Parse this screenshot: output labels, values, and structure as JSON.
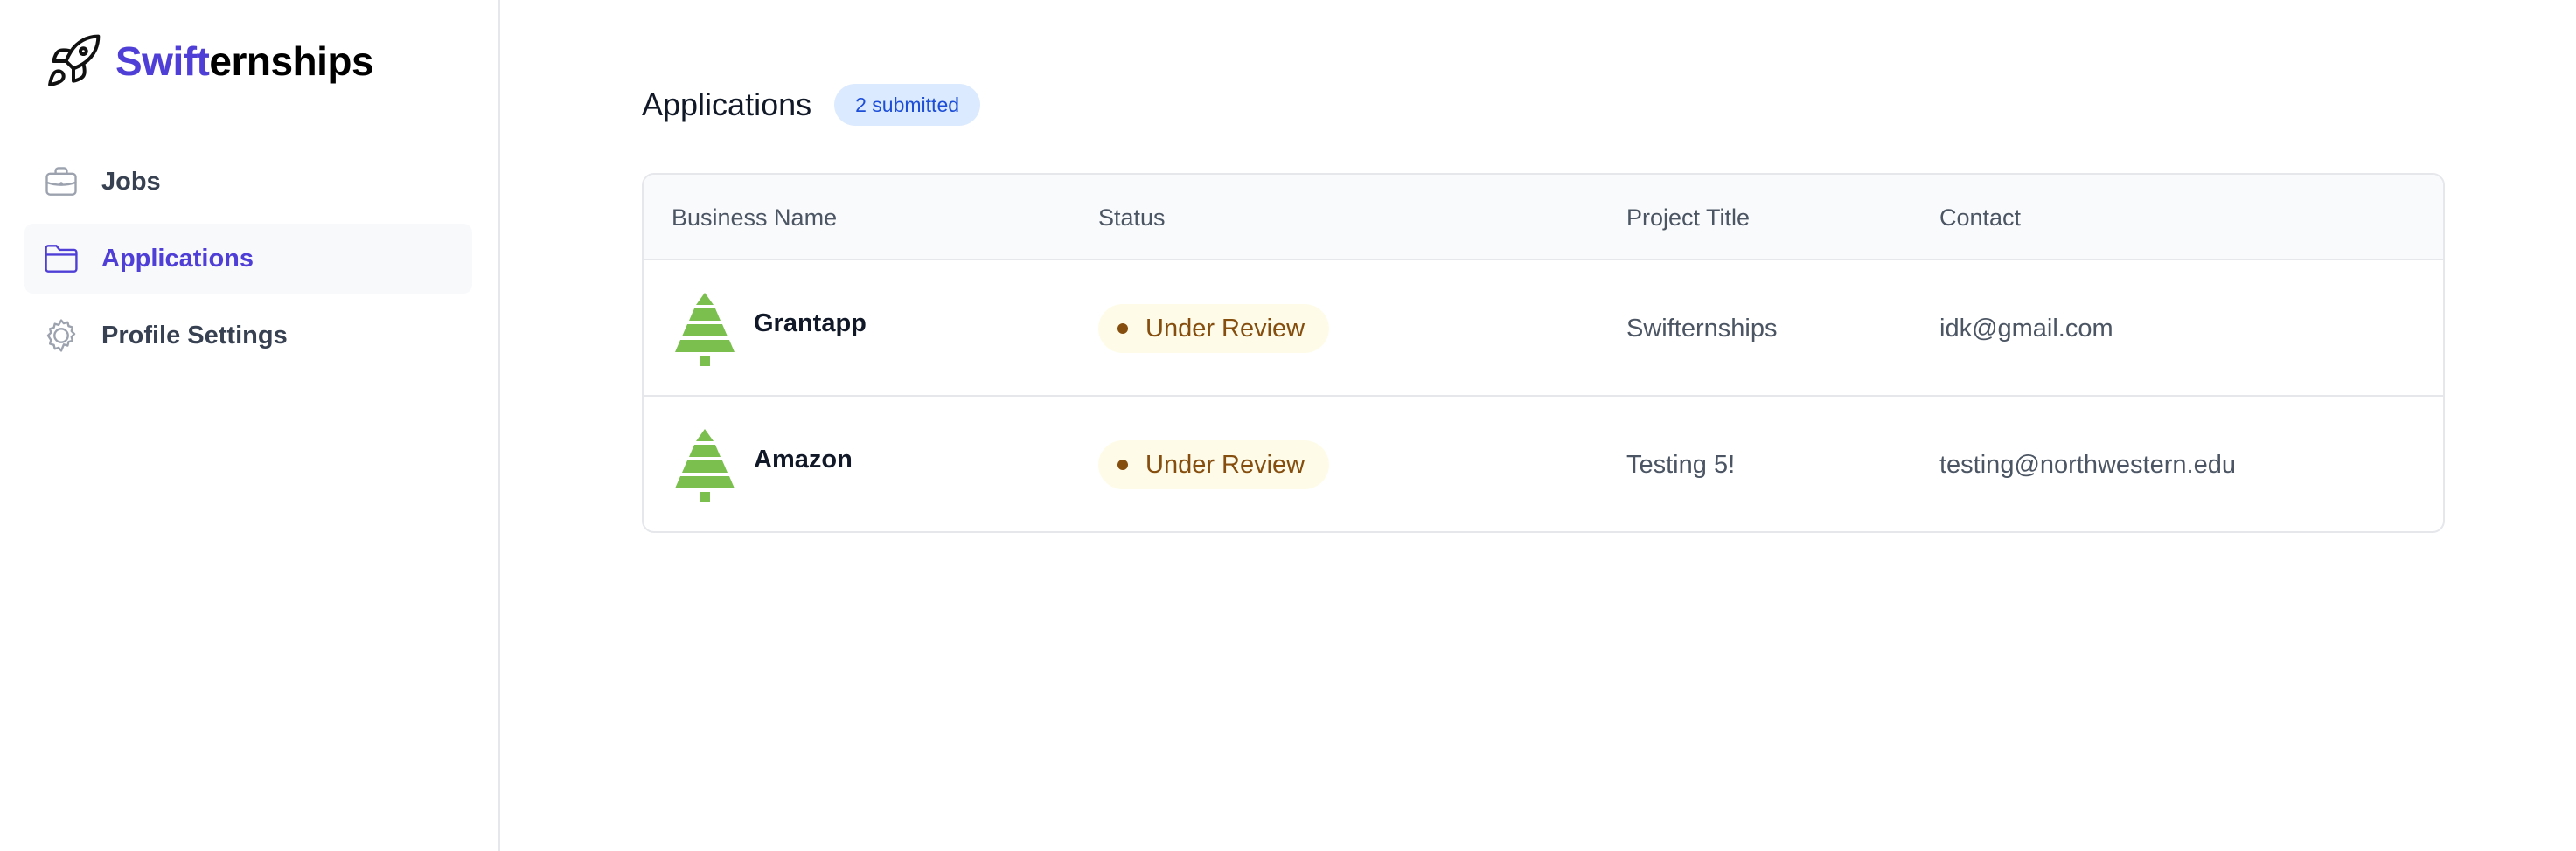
{
  "brand": {
    "name_accent": "Swift",
    "name_rest": "ernships",
    "accent_color": "#4f3fd6",
    "icon": "rocket-icon"
  },
  "sidebar": {
    "items": [
      {
        "label": "Jobs",
        "icon": "briefcase-icon",
        "active": false
      },
      {
        "label": "Applications",
        "icon": "folder-icon",
        "active": true
      },
      {
        "label": "Profile Settings",
        "icon": "gear-icon",
        "active": false
      }
    ]
  },
  "main": {
    "title": "Applications",
    "badge": "2 submitted"
  },
  "table": {
    "columns": [
      "Business Name",
      "Status",
      "Project Title",
      "Contact"
    ],
    "rows": [
      {
        "business": "Grantapp",
        "logo": "tree-icon",
        "status": "Under Review",
        "project": "Swifternships",
        "contact": "idk@gmail.com"
      },
      {
        "business": "Amazon",
        "logo": "tree-icon",
        "status": "Under Review",
        "project": "Testing 5!",
        "contact": "testing@northwestern.edu"
      }
    ]
  },
  "colors": {
    "status_bg": "#fefce8",
    "status_text": "#854d0e",
    "badge_bg": "#dbeafe",
    "badge_text": "#1d4ed8",
    "tree_green": "#7bbf4f"
  }
}
